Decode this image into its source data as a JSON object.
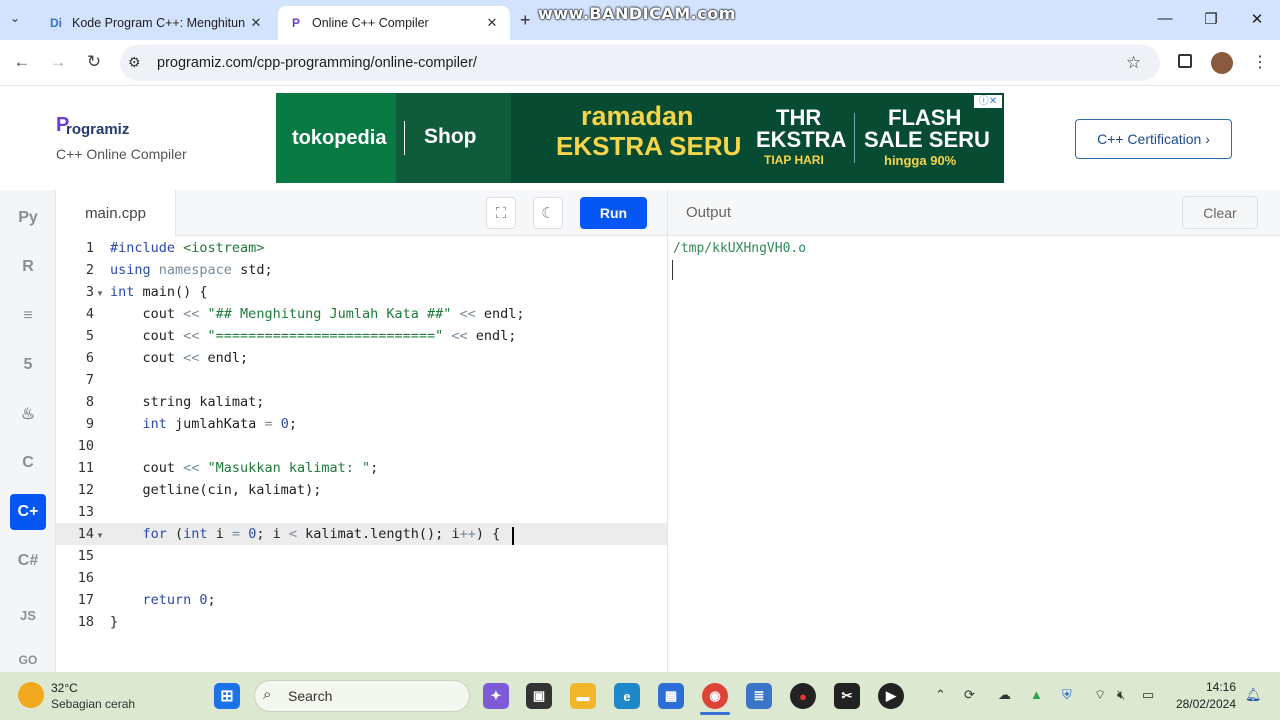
{
  "browser": {
    "tabs": [
      {
        "title": "Kode Program C++: Menghitun",
        "favicon": "Di"
      },
      {
        "title": "Online C++ Compiler",
        "favicon": "P"
      }
    ],
    "watermark": "www.BANDICAM.com",
    "url": "programiz.com/cpp-programming/online-compiler/"
  },
  "header": {
    "logo": "rogramiz",
    "logo_mark": "P",
    "subtitle": "C++ Online Compiler",
    "certification_button": "C++ Certification ›",
    "ad": {
      "brand": "tokopedia",
      "shop": "Shop",
      "headline1": "ramadan",
      "headline2": "EKSTRA SERU",
      "thr1": "THR",
      "thr2": "EKSTRA",
      "thr3": "TIAP HARI",
      "flash1": "FLASH",
      "flash2": "SALE SERU",
      "flash3": "hingga 90%"
    }
  },
  "sidebar": {
    "languages": [
      {
        "name": "python-icon",
        "glyph": "Py"
      },
      {
        "name": "r-icon",
        "glyph": "R"
      },
      {
        "name": "sql-icon",
        "glyph": "≡"
      },
      {
        "name": "html-icon",
        "glyph": "5"
      },
      {
        "name": "java-icon",
        "glyph": "♨"
      },
      {
        "name": "c-icon",
        "glyph": "C"
      },
      {
        "name": "cpp-icon",
        "glyph": "C+",
        "active": true
      },
      {
        "name": "csharp-icon",
        "glyph": "C#"
      },
      {
        "name": "javascript-icon",
        "glyph": "JS"
      },
      {
        "name": "go-icon",
        "glyph": "GO"
      }
    ]
  },
  "editor": {
    "filename": "main.cpp",
    "run_label": "Run",
    "line_numbers": [
      "1",
      "2",
      "3",
      "4",
      "5",
      "6",
      "7",
      "8",
      "9",
      "10",
      "11",
      "12",
      "13",
      "14",
      "15",
      "16",
      "17",
      "18"
    ],
    "active_line": "14"
  },
  "output": {
    "title": "Output",
    "clear_label": "Clear",
    "text": "/tmp/kkUXHngVH0.o"
  },
  "taskbar": {
    "temperature": "32°C",
    "condition": "Sebagian cerah",
    "search_label": "Search",
    "time": "14:16",
    "date": "28/02/2024"
  }
}
